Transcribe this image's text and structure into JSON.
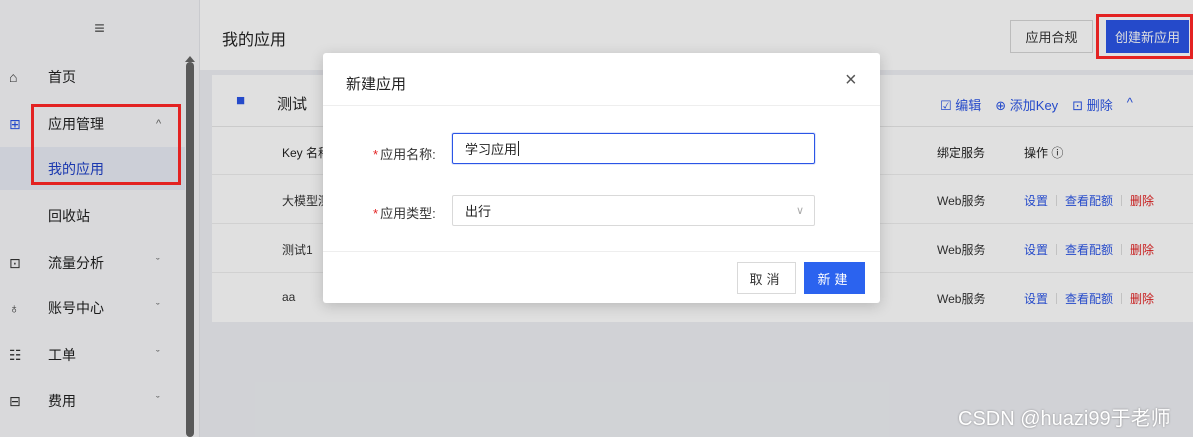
{
  "sidebar": {
    "menu_icon": "≡",
    "items": [
      {
        "icon": "⌂",
        "icon_name": "home-icon",
        "label": "首页"
      },
      {
        "icon": "⊞",
        "icon_name": "grid-icon",
        "label": "应用管理",
        "chevron": "^"
      },
      {
        "label": "我的应用"
      },
      {
        "label": "回收站"
      },
      {
        "icon": "⊡",
        "icon_name": "chart-icon",
        "label": "流量分析",
        "chevron": "ˇ"
      },
      {
        "icon": "♁",
        "icon_name": "user-icon",
        "label": "账号中心",
        "chevron": "ˇ"
      },
      {
        "icon": "☷",
        "icon_name": "ticket-icon",
        "label": "工单",
        "chevron": "ˇ"
      },
      {
        "icon": "⊟",
        "icon_name": "bill-icon",
        "label": "费用",
        "chevron": "ˇ"
      }
    ]
  },
  "header": {
    "title": "我的应用",
    "compliance_label": "应用合规",
    "create_label": "创建新应用"
  },
  "card": {
    "title": "测试",
    "actions": {
      "edit": "☑ 编辑",
      "add_key": "⊕ 添加Key",
      "delete": "⊡ 删除",
      "collapse": "^"
    },
    "columns": {
      "key_name": "Key 名称",
      "service": "绑定服务",
      "ops": "操作 ⓘ"
    },
    "rows": [
      {
        "name": "大模型测",
        "service": "Web服务"
      },
      {
        "name": "测试1",
        "service": "Web服务"
      },
      {
        "name": "aa",
        "service": "Web服务"
      }
    ],
    "row_ops": {
      "settings": "设置",
      "quota": "查看配额",
      "delete": "删除"
    }
  },
  "dialog": {
    "title": "新建应用",
    "close": "×",
    "name_label": "应用名称:",
    "name_value": "学习应用",
    "type_label": "应用类型:",
    "type_value": "出行",
    "cancel": "取消",
    "confirm": "新建"
  },
  "watermark": "CSDN @huazi99于老师",
  "colors": {
    "accent": "#2b55e6",
    "highlight": "#e32222"
  }
}
